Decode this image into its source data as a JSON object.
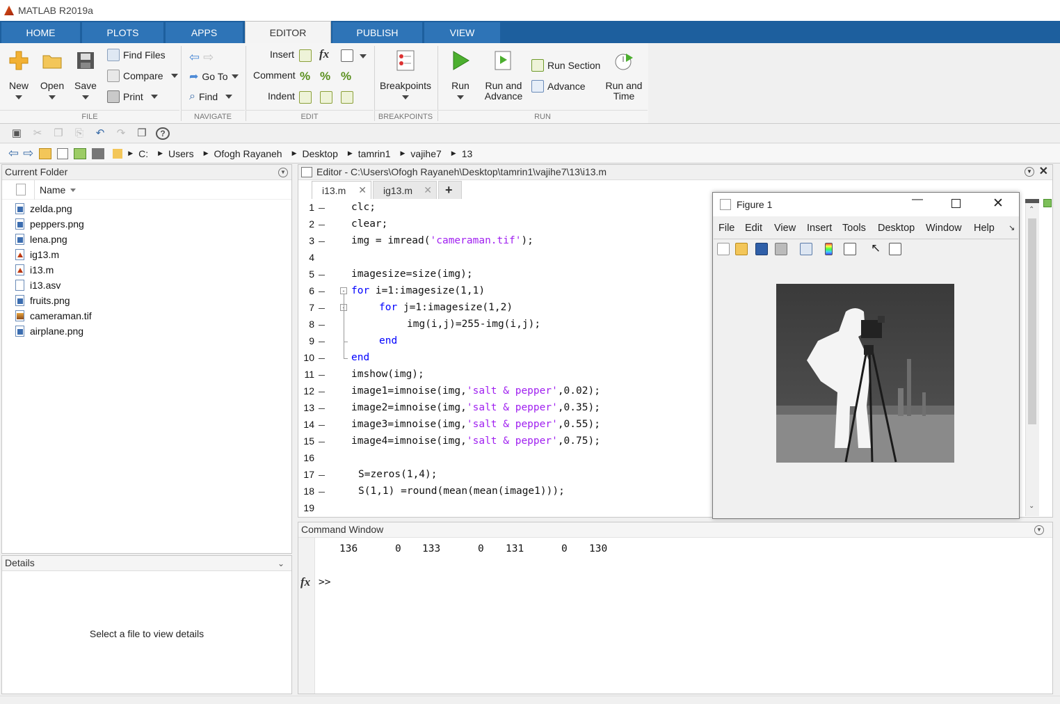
{
  "window": {
    "title": "MATLAB R2019a"
  },
  "ribbon": {
    "tabs": [
      "HOME",
      "PLOTS",
      "APPS",
      "EDITOR",
      "PUBLISH",
      "VIEW"
    ],
    "active_tab": "EDITOR",
    "file": {
      "group": "FILE",
      "new": "New",
      "open": "Open",
      "save": "Save",
      "find_files": "Find Files",
      "compare": "Compare",
      "print": "Print"
    },
    "navigate": {
      "group": "NAVIGATE",
      "goto": "Go To",
      "find": "Find"
    },
    "edit": {
      "group": "EDIT",
      "insert": "Insert",
      "comment": "Comment",
      "indent": "Indent",
      "fx": "fx"
    },
    "breakpoints": {
      "group": "BREAKPOINTS",
      "label": "Breakpoints"
    },
    "run": {
      "group": "RUN",
      "run": "Run",
      "run_advance_1": "Run and",
      "run_advance_2": "Advance",
      "run_section": "Run Section",
      "advance": "Advance",
      "run_time_1": "Run and",
      "run_time_2": "Time"
    }
  },
  "address": {
    "crumbs": [
      "C:",
      "Users",
      "Ofogh Rayaneh",
      "Desktop",
      "tamrin1",
      "vajihe7",
      "13"
    ]
  },
  "current_folder": {
    "title": "Current Folder",
    "column": "Name",
    "files": [
      {
        "name": "zelda.png",
        "type": "img"
      },
      {
        "name": "peppers.png",
        "type": "img"
      },
      {
        "name": "lena.png",
        "type": "img"
      },
      {
        "name": "ig13.m",
        "type": "m"
      },
      {
        "name": "i13.m",
        "type": "m"
      },
      {
        "name": "i13.asv",
        "type": "asv"
      },
      {
        "name": "fruits.png",
        "type": "img"
      },
      {
        "name": "cameraman.tif",
        "type": "tif"
      },
      {
        "name": "airplane.png",
        "type": "img"
      }
    ]
  },
  "details": {
    "title": "Details",
    "message": "Select a file to view details"
  },
  "editor": {
    "title": "Editor - C:\\Users\\Ofogh Rayaneh\\Desktop\\tamrin1\\vajihe7\\13\\i13.m",
    "tabs": [
      "i13.m",
      "ig13.m"
    ],
    "lines": [
      "1",
      "2",
      "3",
      "4",
      "5",
      "6",
      "7",
      "8",
      "9",
      "10",
      "11",
      "12",
      "13",
      "14",
      "15",
      "16",
      "17",
      "18",
      "19"
    ]
  },
  "figure": {
    "title": "Figure 1",
    "menu": [
      "File",
      "Edit",
      "View",
      "Insert",
      "Tools",
      "Desktop",
      "Window",
      "Help"
    ]
  },
  "command_window": {
    "title": "Command Window",
    "output": [
      "136",
      "0",
      "133",
      "0",
      "131",
      "0",
      "130"
    ],
    "prompt": ">>",
    "fx": "fx"
  }
}
